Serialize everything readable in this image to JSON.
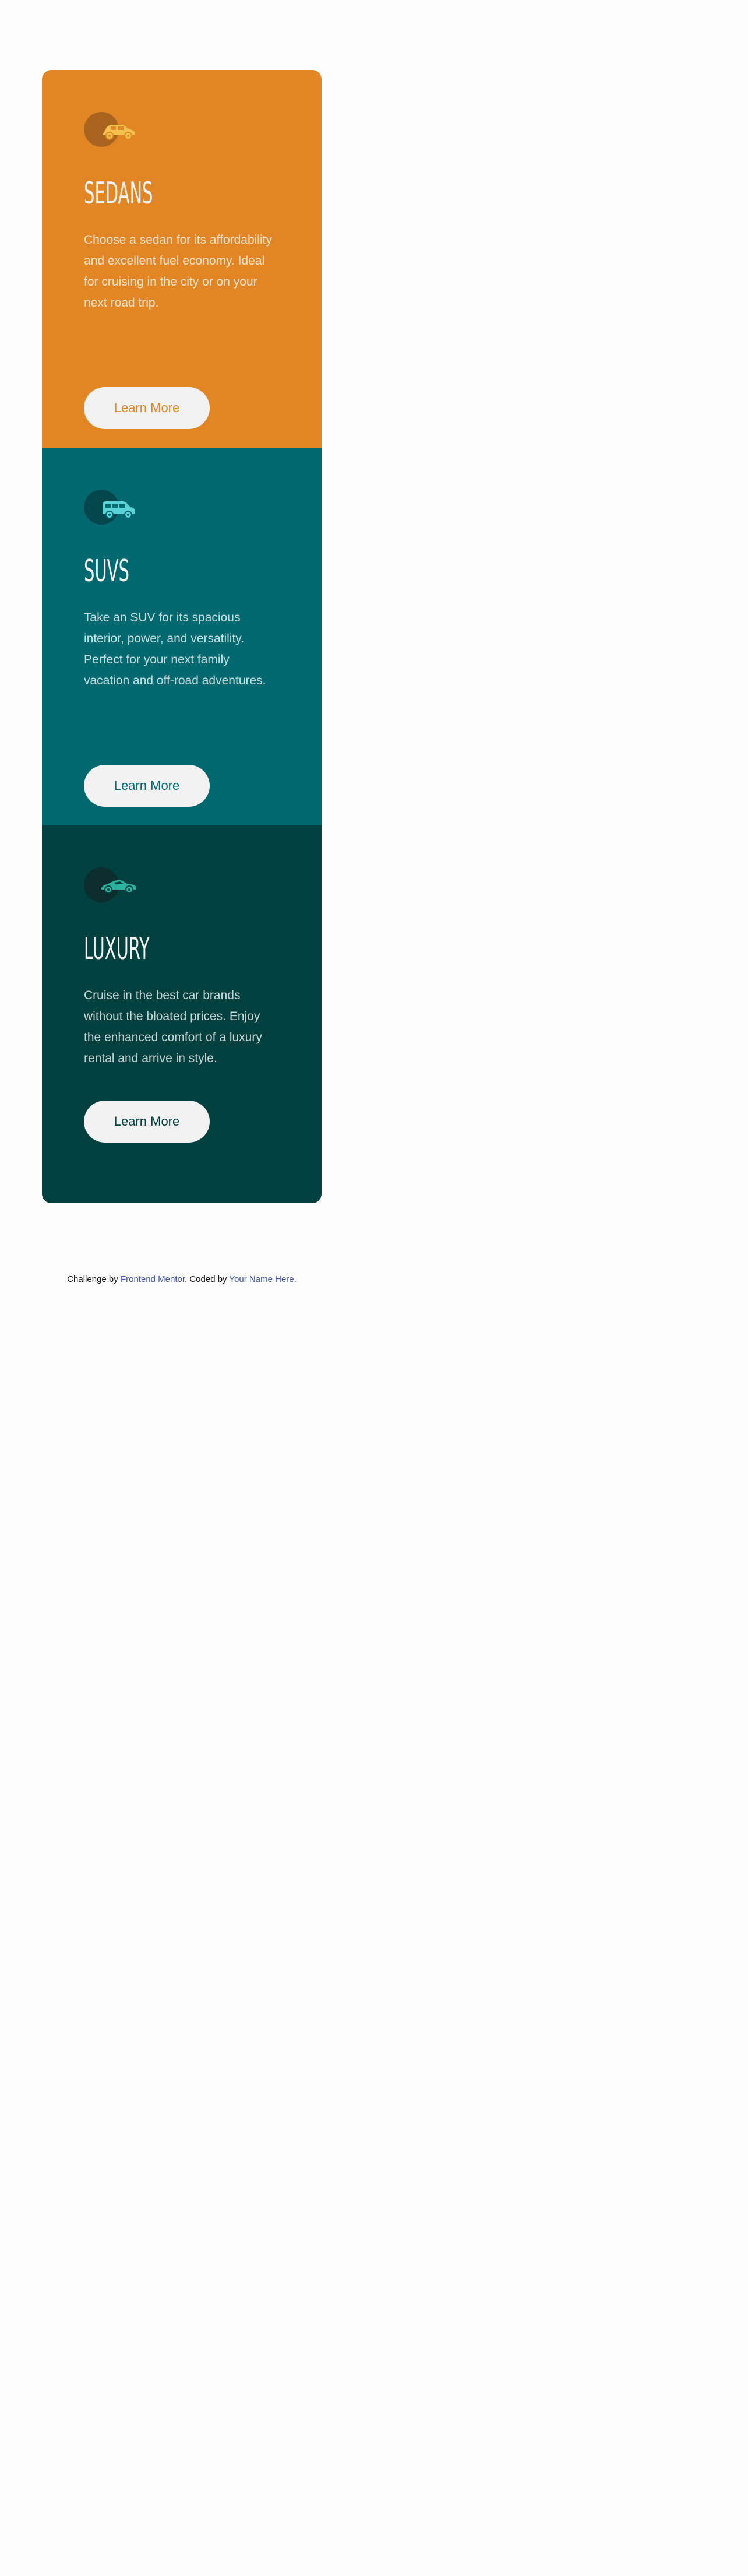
{
  "cards": [
    {
      "title": "Sedans",
      "description": "Choose a sedan for its affordability and excellent fuel economy. Ideal for cruising in the city or on your next road trip.",
      "button_label": "Learn More",
      "icon": "sedan-car-icon",
      "color": "#e28625"
    },
    {
      "title": "SUVs",
      "description": "Take an SUV for its spacious interior, power, and versatility. Perfect for your next family vacation and off-road adventures.",
      "button_label": "Learn More",
      "icon": "suv-car-icon",
      "color": "#006970"
    },
    {
      "title": "Luxury",
      "description": "Cruise in the best car brands without the bloated prices. Enjoy the enhanced comfort of a luxury rental and arrive in style.",
      "button_label": "Learn More",
      "icon": "luxury-car-icon",
      "color": "#004140"
    }
  ],
  "attribution": {
    "prefix": "Challenge by",
    "mentor_link": "Frontend Mentor",
    "middle": ". Coded by",
    "author_link": "Your Name Here",
    "suffix": ".",
    "link_color": "#3e52a3"
  },
  "icon_colors": {
    "sedan": "#f2c14e",
    "suv": "#5ad3d6",
    "luxury": "#2bb3a0"
  }
}
